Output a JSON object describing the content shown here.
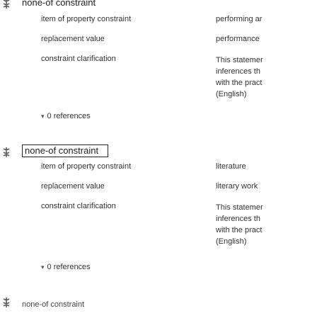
{
  "statements": [
    {
      "title": "none-of constraint",
      "qualifiers": [
        {
          "property": "item of property constraint",
          "value": "performing ar"
        },
        {
          "property": "replacement value",
          "value": "performance"
        },
        {
          "property": "constraint clarification",
          "value_lines": [
            "This statemer",
            "inferences th",
            "with the pract",
            "(English)"
          ]
        }
      ],
      "references": "0 references"
    },
    {
      "title": "none-of constraint",
      "qualifiers": [
        {
          "property": "item of property constraint",
          "value": "literature"
        },
        {
          "property": "replacement value",
          "value": "literary work"
        },
        {
          "property": "constraint clarification",
          "value_lines": [
            "This statemer",
            "inferences th",
            "with the pract",
            "(English)"
          ]
        }
      ],
      "references": "0 references"
    },
    {
      "title": "none-of constraint"
    }
  ]
}
